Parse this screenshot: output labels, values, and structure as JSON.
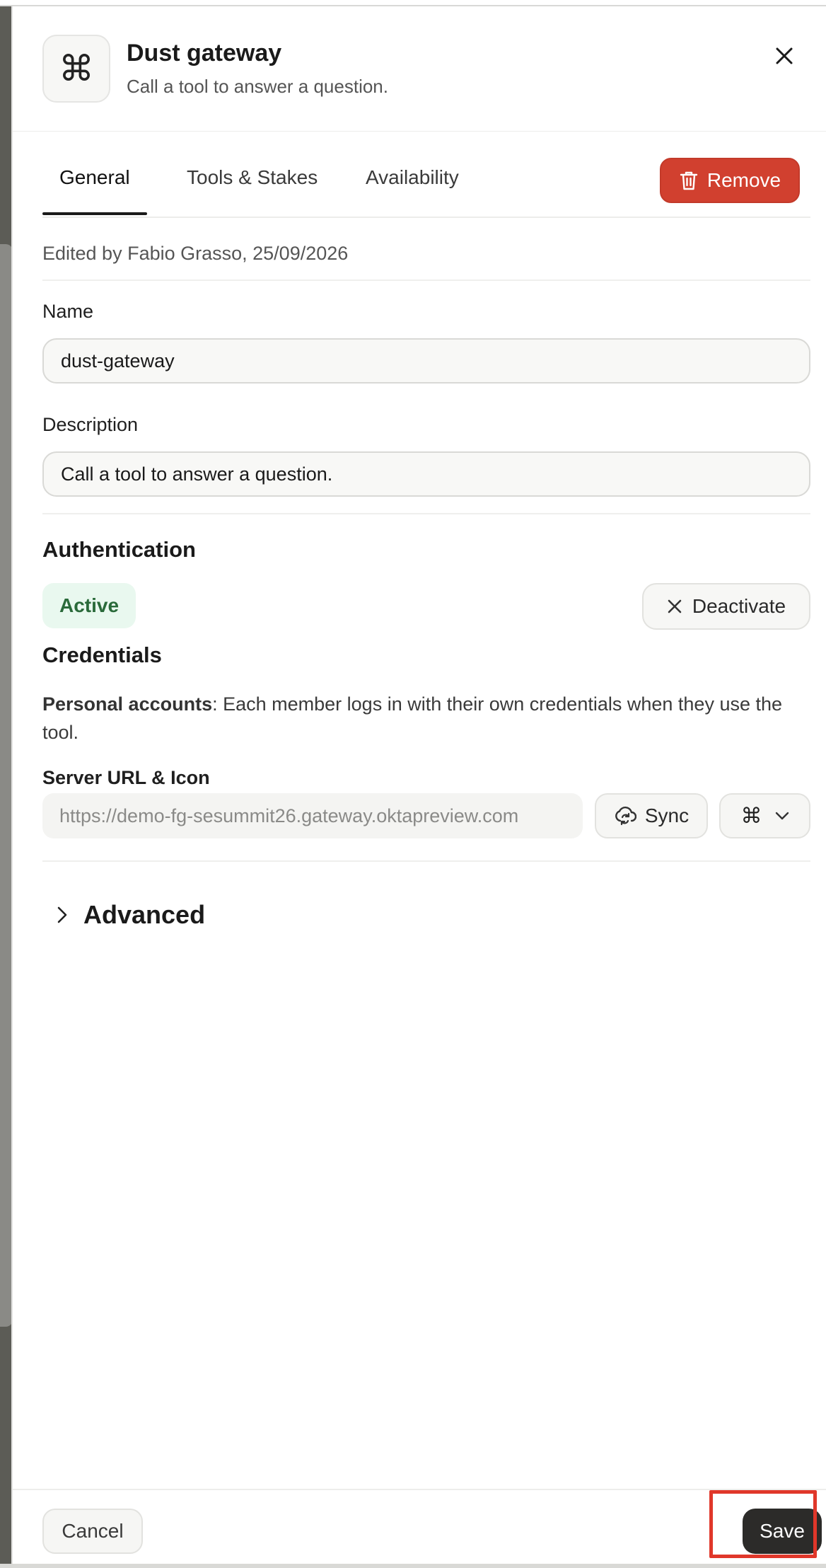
{
  "header": {
    "title": "Dust gateway",
    "subtitle": "Call a tool to answer a question.",
    "icon": "⌘",
    "close_icon": "close-icon"
  },
  "tabs": [
    {
      "label": "General",
      "active": true
    },
    {
      "label": "Tools & Stakes",
      "active": false
    },
    {
      "label": "Availability",
      "active": false
    }
  ],
  "remove_button": {
    "label": "Remove",
    "color": "#d1402f"
  },
  "edited_by": "Edited by Fabio Grasso, 25/09/2026",
  "form": {
    "name_label": "Name",
    "name_value": "dust-gateway",
    "description_label": "Description",
    "description_value": "Call a tool to answer a question."
  },
  "authentication": {
    "title": "Authentication",
    "status": "Active",
    "status_color": "#2a6a3a",
    "deactivate_label": "Deactivate"
  },
  "credentials": {
    "title": "Credentials",
    "emphasis": "Personal accounts",
    "text": ": Each member logs in with their own credentials when they use the tool.",
    "url_label": "Server URL & Icon",
    "url_value": "https://demo-fg-sesummit26.gateway.oktapreview.com",
    "sync_label": "Sync",
    "icon_value": "⌘"
  },
  "advanced": {
    "label": "Advanced"
  },
  "footer": {
    "cancel_label": "Cancel",
    "save_label": "Save",
    "highlight_color": "#e0372a"
  }
}
